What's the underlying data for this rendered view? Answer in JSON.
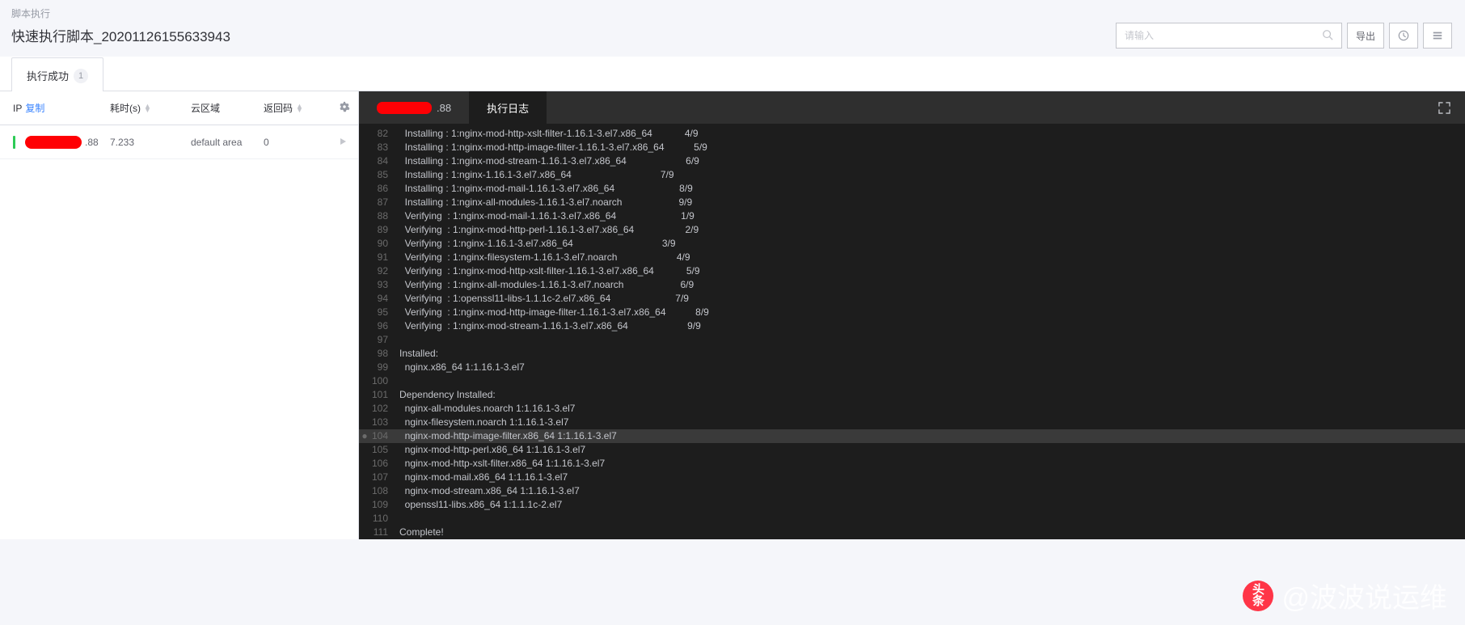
{
  "breadcrumb": "脚本执行",
  "page_title": "快速执行脚本_20201126155633943",
  "search": {
    "placeholder": "请输入"
  },
  "export_btn": "导出",
  "tab": {
    "label": "执行成功",
    "count": "1"
  },
  "table_head": {
    "ip": "IP",
    "copy": "复制",
    "time": "耗时(s)",
    "area": "云区域",
    "ret": "返回码"
  },
  "row": {
    "ip_suffix": ".88",
    "time": "7.233",
    "area": "default area",
    "ret": "0"
  },
  "log_tabs": {
    "ip_suffix": ".88",
    "log_label": "执行日志"
  },
  "log_lines": [
    {
      "n": "82",
      "dot": false,
      "hl": false,
      "t": "  Installing : 1:nginx-mod-http-xslt-filter-1.16.1-3.el7.x86_64            4/9"
    },
    {
      "n": "83",
      "dot": false,
      "hl": false,
      "t": "  Installing : 1:nginx-mod-http-image-filter-1.16.1-3.el7.x86_64           5/9"
    },
    {
      "n": "84",
      "dot": false,
      "hl": false,
      "t": "  Installing : 1:nginx-mod-stream-1.16.1-3.el7.x86_64                      6/9"
    },
    {
      "n": "85",
      "dot": false,
      "hl": false,
      "t": "  Installing : 1:nginx-1.16.1-3.el7.x86_64                                 7/9"
    },
    {
      "n": "86",
      "dot": false,
      "hl": false,
      "t": "  Installing : 1:nginx-mod-mail-1.16.1-3.el7.x86_64                        8/9"
    },
    {
      "n": "87",
      "dot": false,
      "hl": false,
      "t": "  Installing : 1:nginx-all-modules-1.16.1-3.el7.noarch                     9/9"
    },
    {
      "n": "88",
      "dot": false,
      "hl": false,
      "t": "  Verifying  : 1:nginx-mod-mail-1.16.1-3.el7.x86_64                        1/9"
    },
    {
      "n": "89",
      "dot": false,
      "hl": false,
      "t": "  Verifying  : 1:nginx-mod-http-perl-1.16.1-3.el7.x86_64                   2/9"
    },
    {
      "n": "90",
      "dot": false,
      "hl": false,
      "t": "  Verifying  : 1:nginx-1.16.1-3.el7.x86_64                                 3/9"
    },
    {
      "n": "91",
      "dot": false,
      "hl": false,
      "t": "  Verifying  : 1:nginx-filesystem-1.16.1-3.el7.noarch                      4/9"
    },
    {
      "n": "92",
      "dot": false,
      "hl": false,
      "t": "  Verifying  : 1:nginx-mod-http-xslt-filter-1.16.1-3.el7.x86_64            5/9"
    },
    {
      "n": "93",
      "dot": false,
      "hl": false,
      "t": "  Verifying  : 1:nginx-all-modules-1.16.1-3.el7.noarch                     6/9"
    },
    {
      "n": "94",
      "dot": false,
      "hl": false,
      "t": "  Verifying  : 1:openssl11-libs-1.1.1c-2.el7.x86_64                        7/9"
    },
    {
      "n": "95",
      "dot": false,
      "hl": false,
      "t": "  Verifying  : 1:nginx-mod-http-image-filter-1.16.1-3.el7.x86_64           8/9"
    },
    {
      "n": "96",
      "dot": false,
      "hl": false,
      "t": "  Verifying  : 1:nginx-mod-stream-1.16.1-3.el7.x86_64                      9/9"
    },
    {
      "n": "97",
      "dot": false,
      "hl": false,
      "t": ""
    },
    {
      "n": "98",
      "dot": false,
      "hl": false,
      "t": "Installed:"
    },
    {
      "n": "99",
      "dot": false,
      "hl": false,
      "t": "  nginx.x86_64 1:1.16.1-3.el7"
    },
    {
      "n": "100",
      "dot": false,
      "hl": false,
      "t": ""
    },
    {
      "n": "101",
      "dot": false,
      "hl": false,
      "t": "Dependency Installed:"
    },
    {
      "n": "102",
      "dot": false,
      "hl": false,
      "t": "  nginx-all-modules.noarch 1:1.16.1-3.el7"
    },
    {
      "n": "103",
      "dot": false,
      "hl": false,
      "t": "  nginx-filesystem.noarch 1:1.16.1-3.el7"
    },
    {
      "n": "104",
      "dot": true,
      "hl": true,
      "t": "  nginx-mod-http-image-filter.x86_64 1:1.16.1-3.el7"
    },
    {
      "n": "105",
      "dot": false,
      "hl": false,
      "t": "  nginx-mod-http-perl.x86_64 1:1.16.1-3.el7"
    },
    {
      "n": "106",
      "dot": false,
      "hl": false,
      "t": "  nginx-mod-http-xslt-filter.x86_64 1:1.16.1-3.el7"
    },
    {
      "n": "107",
      "dot": false,
      "hl": false,
      "t": "  nginx-mod-mail.x86_64 1:1.16.1-3.el7"
    },
    {
      "n": "108",
      "dot": false,
      "hl": false,
      "t": "  nginx-mod-stream.x86_64 1:1.16.1-3.el7"
    },
    {
      "n": "109",
      "dot": false,
      "hl": false,
      "t": "  openssl11-libs.x86_64 1:1.1.1c-2.el7"
    },
    {
      "n": "110",
      "dot": false,
      "hl": false,
      "t": ""
    },
    {
      "n": "111",
      "dot": false,
      "hl": false,
      "t": "Complete!"
    }
  ],
  "watermark": {
    "badge_top": "头",
    "badge_bot": "条",
    "text": "@波波说运维"
  }
}
